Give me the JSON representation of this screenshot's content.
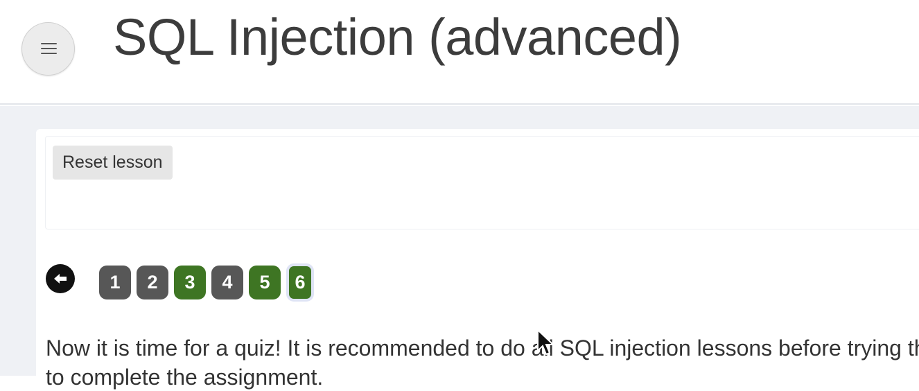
{
  "header": {
    "title": "SQL Injection (advanced)",
    "menu_icon": "hamburger-icon"
  },
  "lesson": {
    "reset_label": "Reset lesson",
    "back_icon": "arrow-left-icon",
    "pages": [
      {
        "label": "1",
        "status": "incomplete"
      },
      {
        "label": "2",
        "status": "incomplete"
      },
      {
        "label": "3",
        "status": "complete"
      },
      {
        "label": "4",
        "status": "incomplete"
      },
      {
        "label": "5",
        "status": "complete"
      },
      {
        "label": "6",
        "status": "complete",
        "current": true
      }
    ],
    "intro_line1": "Now it is time for a quiz! It is recommended to do all SQL injection lessons before trying the",
    "intro_line2": "to complete the assignment."
  },
  "colors": {
    "complete": "#3e7523",
    "incomplete": "#575757",
    "background": "#eff1f5"
  }
}
